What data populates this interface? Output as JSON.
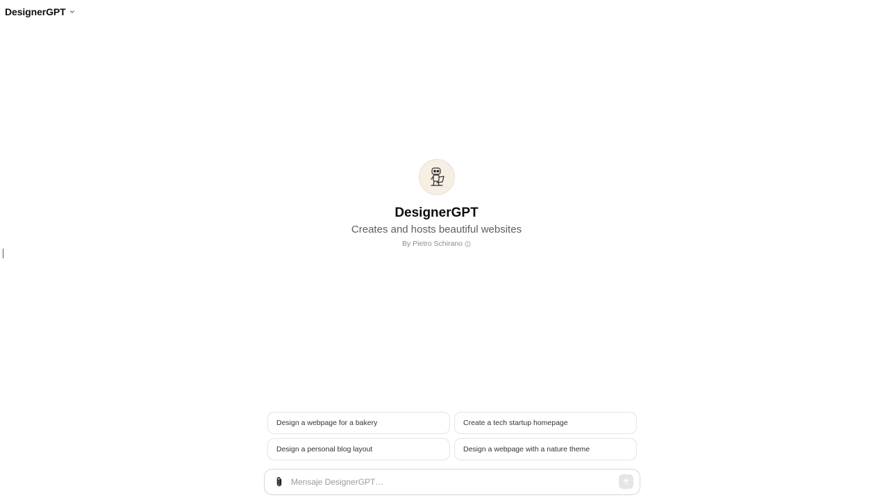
{
  "header": {
    "title": "DesignerGPT",
    "dropdown_icon": "chevron-down-icon"
  },
  "gpt": {
    "avatar_icon": "robot-designer-icon",
    "name": "DesignerGPT",
    "description": "Creates and hosts beautiful websites",
    "author": "By Pietro Schirano",
    "author_info_icon": "info-icon"
  },
  "suggestions": [
    "Design a webpage for a bakery",
    "Create a tech startup homepage",
    "Design a personal blog layout",
    "Design a webpage with a nature theme"
  ],
  "composer": {
    "placeholder": "Mensaje DesignerGPT…",
    "value": "",
    "attach_icon": "paperclip-icon",
    "send_icon": "arrow-up-icon"
  },
  "colors": {
    "background": "#ffffff",
    "avatar_bg": "#f7efe4",
    "send_button_bg": "#e5e5e5",
    "border": "#e3e3e3"
  }
}
